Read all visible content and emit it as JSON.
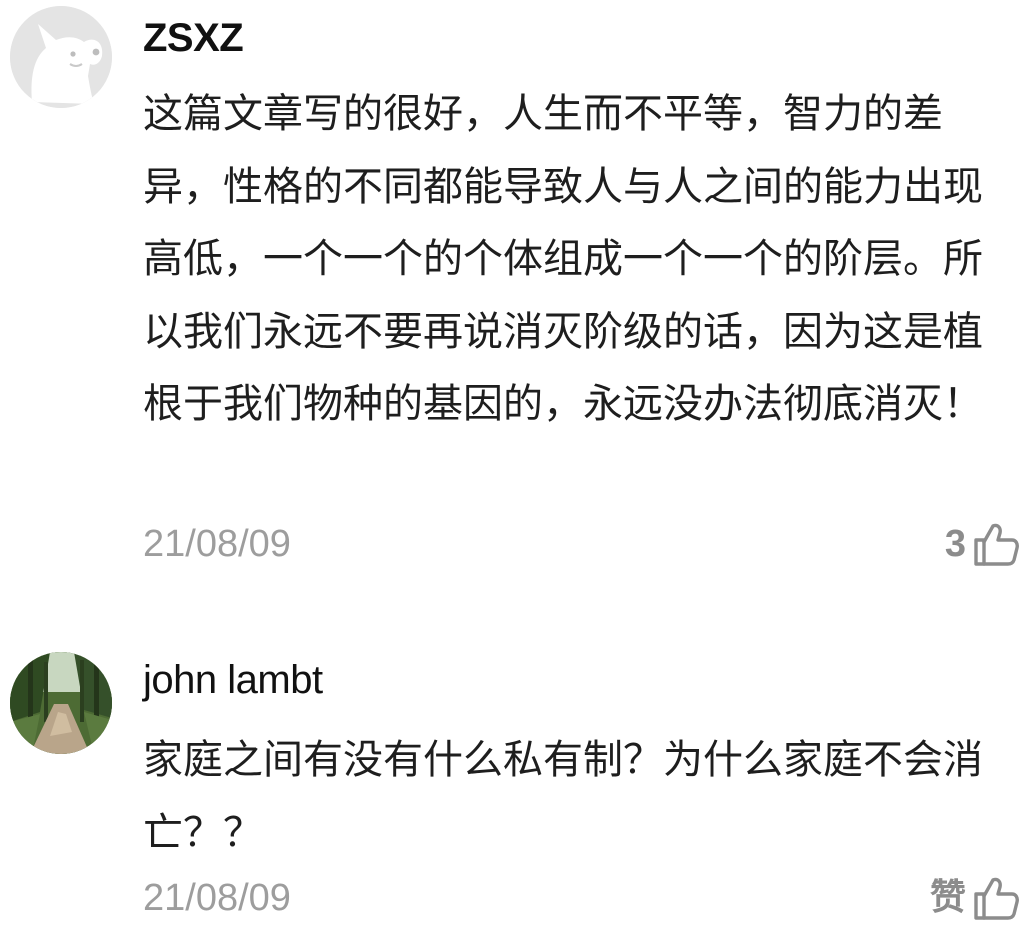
{
  "comments": [
    {
      "username": "ZSXZ",
      "avatar_icon": "default-dog-avatar-icon",
      "text": "这篇文章写的很好，人生而不平等，智力的差异，性格的不同都能导致人与人之间的能力出现高低，一个一个的个体组成一个一个的阶层。所以我们永远不要再说消灭阶级的话，因为这是植根于我们物种的基因的，永远没办法彻底消灭！",
      "date": "21/08/09",
      "likes": "3",
      "like_icon": "thumbs-up-icon"
    },
    {
      "username": "john lambt",
      "avatar_icon": "forest-path-photo-avatar",
      "text": "家庭之间有没有什么私有制？为什么家庭不会消亡？？",
      "date": "21/08/09",
      "like_label": "赞",
      "like_icon": "thumbs-up-icon"
    }
  ],
  "colors": {
    "text": "#1e1e1e",
    "meta": "#9d9d9d",
    "icon": "#8c8c8c",
    "background": "#ffffff"
  }
}
